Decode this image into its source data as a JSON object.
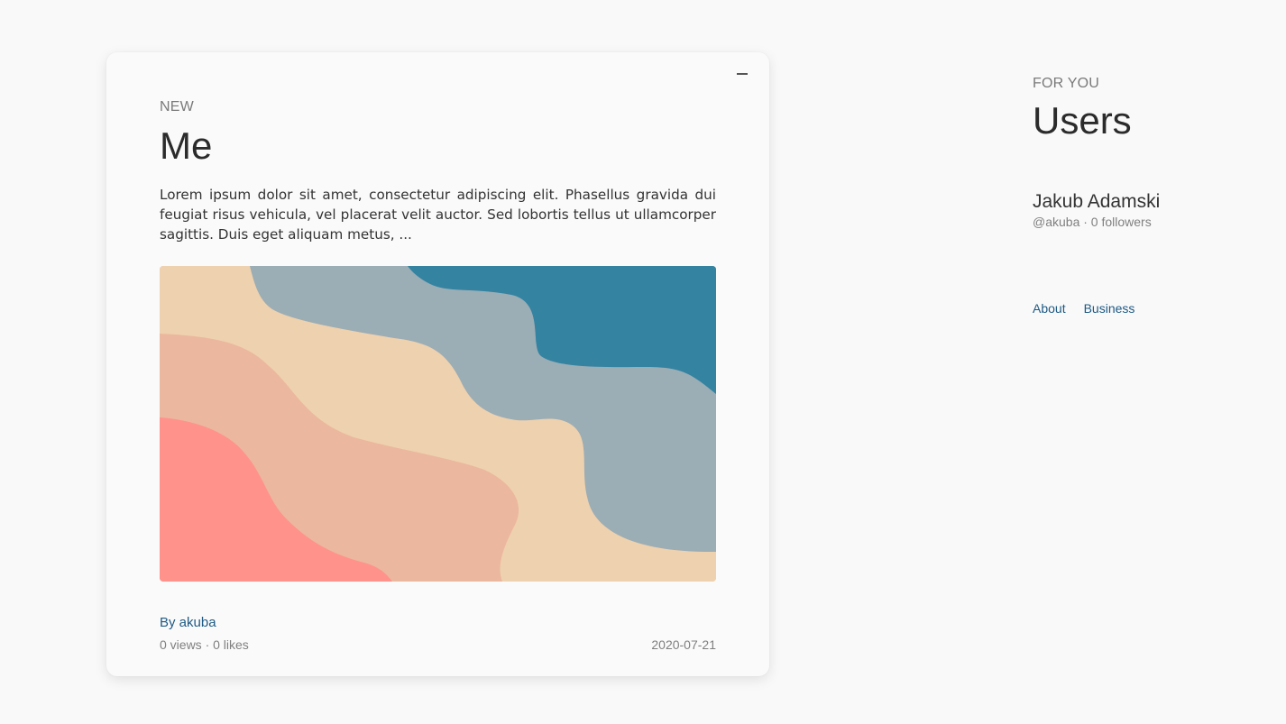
{
  "post": {
    "label": "NEW",
    "title": "Me",
    "excerpt": "Lorem ipsum dolor sit amet, consectetur adipiscing elit. Phasellus gravida dui feugiat risus vehicula, vel placerat velit auctor. Sed lobortis tellus ut ullamcorper sagittis. Duis eget aliquam metus, ...",
    "author": "By akuba",
    "stats": "0 views · 0 likes",
    "date": "2020-07-21",
    "cover_colors": [
      "#ff928b",
      "#ebb79e",
      "#eed1ae",
      "#9badb5",
      "#3383a1"
    ]
  },
  "sidebar": {
    "label": "FOR YOU",
    "title": "Users",
    "user": {
      "name": "Jakub Adamski",
      "meta": "@akuba · 0 followers"
    },
    "links": [
      "About",
      "Business"
    ]
  }
}
